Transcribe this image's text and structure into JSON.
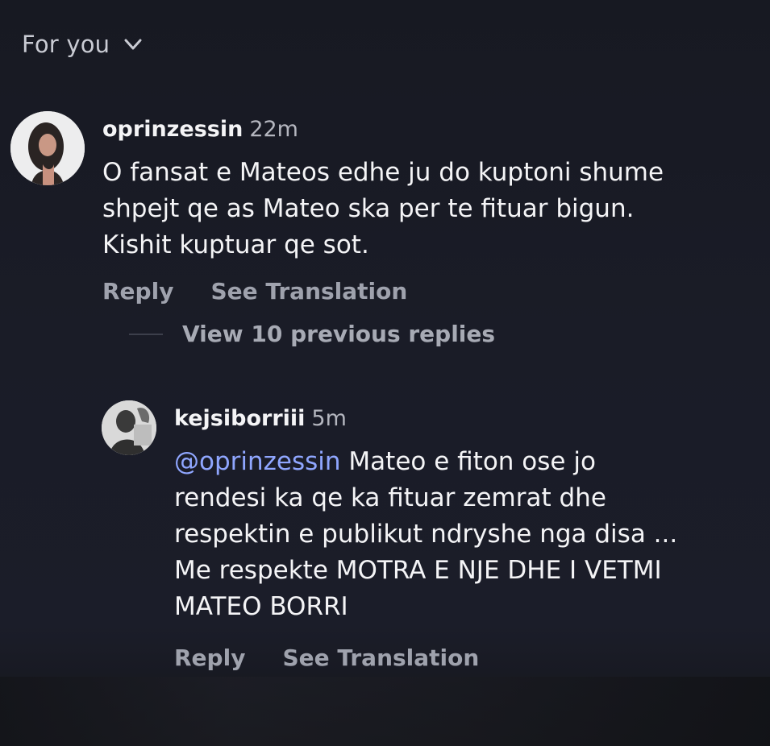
{
  "header": {
    "feed_label": "For you",
    "chevron_icon": "chevron-down-icon"
  },
  "comments": [
    {
      "avatar_icon": "profile-photo-avatar",
      "username": "oprinzessin",
      "time": "22m",
      "text": "O fansat e Mateos edhe ju do kuptoni shume\nshpejt qe as Mateo ska per te fituar bigun.\nKishit kuptuar qe sot.",
      "reply_label": "Reply",
      "translate_label": "See Translation"
    }
  ],
  "thread": {
    "view_replies_label": "View 10 previous replies"
  },
  "replies": [
    {
      "avatar_icon": "profile-photo-avatar",
      "username": "kejsiborriii",
      "time": "5m",
      "mention": "@oprinzessin",
      "text": " Mateo e fiton ose jo\nrendesi ka qe ka fituar zemrat dhe\nrespektin e publikut ndryshe nga disa ...\nMe respekte MOTRA E NJE DHE I VETMI\nMATEO BORRI",
      "reply_label": "Reply",
      "translate_label": "See Translation"
    }
  ],
  "colors": {
    "background": "#1a1c27",
    "text": "#f4f4f6",
    "muted": "#9fa2ad",
    "mention": "#8fa6ff"
  }
}
